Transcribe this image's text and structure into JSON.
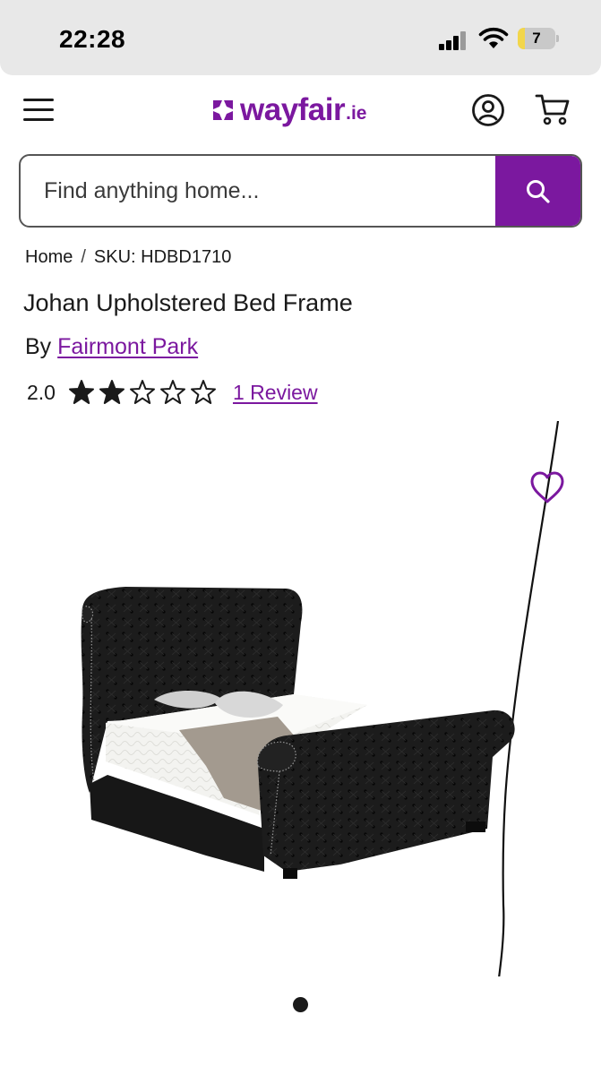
{
  "status_bar": {
    "time": "22:28",
    "battery_level": "7",
    "icons": [
      "signal-icon",
      "wifi-icon",
      "battery-icon"
    ]
  },
  "header": {
    "logo_text": "wayfair",
    "logo_tld": ".ie",
    "icons": [
      "menu-icon",
      "account-icon",
      "cart-icon"
    ]
  },
  "search": {
    "placeholder": "Find anything home...",
    "button_icon": "search-icon"
  },
  "breadcrumb": {
    "home": "Home",
    "separator": "/",
    "sku": "SKU: HDBD1710"
  },
  "product": {
    "title": "Johan Upholstered Bed Frame",
    "by_label": "By",
    "brand": "Fairmont Park",
    "rating": "2.0",
    "rating_value": 2,
    "rating_max": 5,
    "review_link": "1 Review",
    "favorite_icon": "heart-outline-icon"
  },
  "gallery": {
    "image_count": 1,
    "active_index": 0
  },
  "colors": {
    "brand_purple": "#7b189f",
    "text": "#1a1a1a",
    "status_bar_bg": "#e8e8e8",
    "battery_fill": "#f2d64b"
  }
}
